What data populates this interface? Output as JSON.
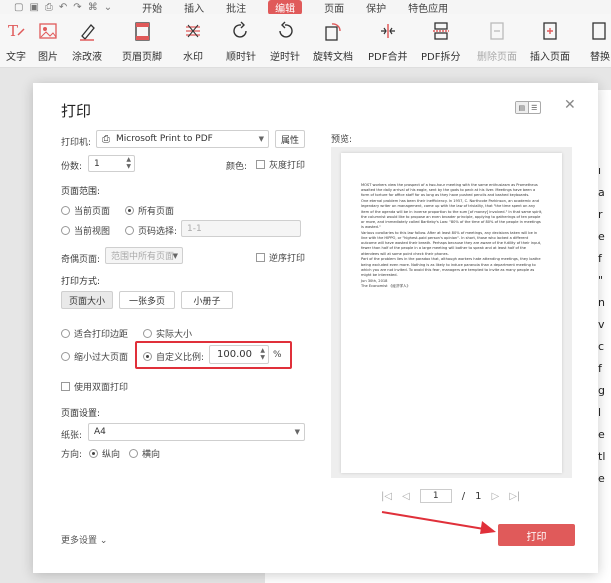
{
  "menubar": {
    "items": [
      "开始",
      "插入",
      "批注",
      "编辑",
      "页面",
      "保护",
      "特色应用"
    ],
    "active_index": 3
  },
  "ribbon": {
    "text": "文字",
    "image": "图片",
    "eraser": "涂改液",
    "header_footer": "页眉页脚",
    "watermark": "水印",
    "clockwise": "顺时针",
    "counterclockwise": "逆时针",
    "rotate_doc": "旋转文档",
    "pdf_merge": "PDF合并",
    "pdf_split": "PDF拆分",
    "delete_page": "删除页面",
    "insert_page": "插入页面",
    "replace": "替换"
  },
  "doc": {
    "side_chars": [
      "ı",
      "a",
      "r",
      "e",
      "f",
      "\"",
      "n",
      "v",
      "c",
      "",
      "f",
      "g",
      "l",
      "e",
      "",
      "tl",
      "e"
    ]
  },
  "dialog": {
    "title": "打印",
    "printer_label": "打印机:",
    "printer_value": "Microsoft Print to PDF",
    "properties_button": "属性",
    "copies_label": "份数:",
    "copies_value": "1",
    "color_label": "颜色:",
    "grayscale": "灰度打印",
    "page_range_title": "页面范围:",
    "current_page": "当前页面",
    "all_pages": "所有页面",
    "current_view": "当前视图",
    "page_select": "页码选择:",
    "page_select_placeholder": "1-1",
    "odd_even_label": "奇偶页面:",
    "odd_even_value": "范围中所有页面",
    "reverse": "逆序打印",
    "print_mode_title": "打印方式:",
    "mode_page_size": "页面大小",
    "mode_multi": "一张多页",
    "mode_booklet": "小册子",
    "fit_margin": "适合打印边距",
    "actual_size": "实际大小",
    "shrink_large": "缩小过大页面",
    "custom_scale": "自定义比例:",
    "scale_value": "100.00",
    "scale_unit": "%",
    "duplex": "使用双面打印",
    "page_setup_title": "页面设置:",
    "paper_label": "纸张:",
    "paper_value": "A4",
    "orientation_label": "方向:",
    "portrait": "纵向",
    "landscape": "横向",
    "preview_label": "预览:",
    "page_current": "1",
    "page_sep": "/",
    "page_total": "1",
    "more_settings": "更多设置",
    "print_button": "打印"
  },
  "preview_text": [
    "MOST workers view the prospect of a two-hour meeting with the same enthusiasm as Prometheus awaited the daily arrival of his eagle, sent by the gods to peck at his liver. Meetings have been a form of torture for office staff for as long as they have pushed pencils and bashed keyboards.",
    "One eternal problem has been their inefficiency. In 1957, C. Northcote Parkinson, an academic and legendary writer on management, came up with the law of triviality, that \"the time spent on any item of the agenda will be in inverse proportion to the sum [of money] involved.\" In that same spirit, the columnist would like to propose an even broader principle, applying to gatherings of ten people or more, and immediately called Bartleby's Law: \"80% of the time of 80% of the people in meetings is wasted.\"",
    "Various corollaries to this law follow. After at least 80% of meetings, any decisions taken will be in line with the HIPPO, or \"highest-paid person's opinion\". In short, those who lacked a different outcome will have wasted their breath. Perhaps because they are aware of the futility of their input, fewer than half of the people in a large meeting will bother to speak and at least half of the attendees will at some point check their phones.",
    "Part of the problem lies in the paradox that, although workers hate attending meetings, they loathe being excluded even more. Nothing is as likely to induce paranoia than a department meeting to which you are not invited. To avoid this fear, managers are tempted to invite as many people as might be interested.",
    "Jun 30th, 2018",
    "The Economist 《经济学人》"
  ],
  "colors": {
    "accent": "#e05a5a",
    "highlight": "#e0303a"
  }
}
